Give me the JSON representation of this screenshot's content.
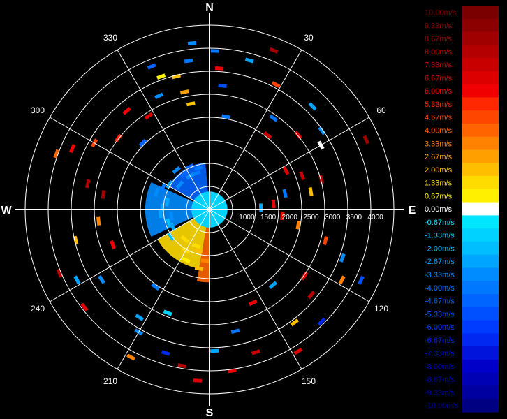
{
  "chart_data": {
    "type": "polar-radar",
    "compass": {
      "north": "N",
      "east": "E",
      "south": "S",
      "west": "W"
    },
    "azimuth_labels": [
      "30",
      "60",
      "120",
      "150",
      "210",
      "240",
      "300",
      "330"
    ],
    "azimuth_degrees": [
      30,
      60,
      120,
      150,
      210,
      240,
      300,
      330
    ],
    "range_labels": [
      "1000",
      "1500",
      "2000",
      "2500",
      "3000",
      "3500",
      "4000"
    ],
    "range_values": [
      1000,
      1500,
      2000,
      2500,
      3000,
      3500,
      4000
    ],
    "range_max": 4300,
    "grid": true,
    "legend_placement": "right",
    "colorbar": {
      "title": "",
      "labels": [
        "10.00m/s",
        "9.33m/s",
        "8.67m/s",
        "8.00m/s",
        "7.33m/s",
        "6.67m/s",
        "6.00m/s",
        "5.33m/s",
        "4.67m/s",
        "4.00m/s",
        "3.33m/s",
        "2.67m/s",
        "2.00m/s",
        "1.33m/s",
        "0.67m/s",
        "0.00m/s",
        "-0.67m/s",
        "-1.33m/s",
        "-2.00m/s",
        "-2.67m/s",
        "-3.33m/s",
        "-4.00m/s",
        "-4.67m/s",
        "-5.33m/s",
        "-6.00m/s",
        "-6.67m/s",
        "-7.33m/s",
        "-8.00m/s",
        "-8.67m/s",
        "-9.33m/s",
        "-10.00m/s"
      ],
      "values": [
        10,
        9.33,
        8.67,
        8,
        7.33,
        6.67,
        6,
        5.33,
        4.67,
        4,
        3.33,
        2.67,
        2,
        1.33,
        0.67,
        0,
        -0.67,
        -1.33,
        -2,
        -2.67,
        -3.33,
        -4,
        -4.67,
        -5.33,
        -6,
        -6.67,
        -7.33,
        -8,
        -8.67,
        -9.33,
        -10
      ],
      "colors": [
        "#7a0000",
        "#8c0000",
        "#a00000",
        "#b40000",
        "#c80000",
        "#dc0000",
        "#f00000",
        "#ff2800",
        "#ff4600",
        "#ff6400",
        "#ff8200",
        "#ffa000",
        "#ffbe00",
        "#ffdc00",
        "#fff000",
        "#ffffff",
        "#00e6ff",
        "#00d2ff",
        "#00beff",
        "#00a5ff",
        "#008cff",
        "#0078ff",
        "#0064ff",
        "#0050ff",
        "#003cff",
        "#0028f0",
        "#0014dc",
        "#0000c8",
        "#0000b4",
        "#0000a0",
        "#000082"
      ]
    },
    "gates": [
      {
        "az": -15,
        "r": 1000,
        "v": -4
      },
      {
        "az": -20,
        "r": 900,
        "v": -4
      },
      {
        "az": -25,
        "r": 1100,
        "v": -4.67
      },
      {
        "az": -30,
        "r": 900,
        "v": -3.33
      },
      {
        "az": -35,
        "r": 1000,
        "v": -4.67
      },
      {
        "az": -40,
        "r": 1200,
        "v": -3.33
      },
      {
        "az": -50,
        "r": 900,
        "v": -3.33
      },
      {
        "az": -58,
        "r": 1100,
        "v": -2.67
      },
      {
        "az": -65,
        "r": 1200,
        "v": -4
      },
      {
        "az": -72,
        "r": 1300,
        "v": -3.33
      },
      {
        "az": -80,
        "r": 1000,
        "v": -2.67
      },
      {
        "az": -88,
        "r": 1100,
        "v": -2.67
      },
      {
        "az": -95,
        "r": 1150,
        "v": -2.67
      },
      {
        "az": -100,
        "r": 900,
        "v": -3.33
      },
      {
        "az": -108,
        "r": 1000,
        "v": -2
      },
      {
        "az": -115,
        "r": 950,
        "v": -2.67
      },
      {
        "az": -125,
        "r": 1100,
        "v": -2
      },
      {
        "az": -140,
        "r": 900,
        "v": 1.33
      },
      {
        "az": -150,
        "r": 1100,
        "v": 1.33
      },
      {
        "az": -155,
        "r": 1300,
        "v": 0.67
      },
      {
        "az": -160,
        "r": 900,
        "v": 1.33
      },
      {
        "az": -165,
        "r": 1000,
        "v": 2
      },
      {
        "az": -170,
        "r": 1400,
        "v": 2
      },
      {
        "az": -175,
        "r": 1200,
        "v": 3.33
      },
      {
        "az": -10,
        "r": 2500,
        "v": 2
      },
      {
        "az": -12,
        "r": 2800,
        "v": 2.67
      },
      {
        "az": -14,
        "r": 3200,
        "v": 2
      },
      {
        "az": -8,
        "r": 3500,
        "v": -4
      },
      {
        "az": -6,
        "r": 3900,
        "v": -3.33
      },
      {
        "az": -22,
        "r": 3600,
        "v": -4.67
      },
      {
        "az": -20,
        "r": 3300,
        "v": 0.67
      },
      {
        "az": -24,
        "r": 2900,
        "v": -3.33
      },
      {
        "az": -33,
        "r": 2600,
        "v": 6.67
      },
      {
        "az": -40,
        "r": 3000,
        "v": 6
      },
      {
        "az": -45,
        "r": 2200,
        "v": -4.67
      },
      {
        "az": -52,
        "r": 2700,
        "v": 5.33
      },
      {
        "az": -60,
        "r": 3100,
        "v": 4.67
      },
      {
        "az": -66,
        "r": 3500,
        "v": 6
      },
      {
        "az": -70,
        "r": 3800,
        "v": 4
      },
      {
        "az": -78,
        "r": 2900,
        "v": 8
      },
      {
        "az": -82,
        "r": 2500,
        "v": 8.67
      },
      {
        "az": -96,
        "r": 2600,
        "v": 3.33
      },
      {
        "az": -103,
        "r": 3200,
        "v": 2
      },
      {
        "az": -110,
        "r": 2400,
        "v": 6
      },
      {
        "az": -113,
        "r": 3800,
        "v": 8
      },
      {
        "az": -118,
        "r": 3500,
        "v": -2.67
      },
      {
        "az": -123,
        "r": 3000,
        "v": -3.33
      },
      {
        "az": -128,
        "r": 3700,
        "v": 6.67
      },
      {
        "az": -145,
        "r": 2200,
        "v": -4
      },
      {
        "az": -147,
        "r": 3000,
        "v": -2.67
      },
      {
        "az": -150,
        "r": 3300,
        "v": -3.33
      },
      {
        "az": -152,
        "r": 3900,
        "v": 3.33
      },
      {
        "az": -158,
        "r": 2600,
        "v": -1.33
      },
      {
        "az": -163,
        "r": 3500,
        "v": -6.67
      },
      {
        "az": -170,
        "r": 3700,
        "v": 8
      },
      {
        "az": -176,
        "r": 4000,
        "v": 6.67
      },
      {
        "az": 2,
        "r": 3700,
        "v": -4
      },
      {
        "az": 4,
        "r": 3300,
        "v": 6
      },
      {
        "az": 6,
        "r": 2900,
        "v": -5.33
      },
      {
        "az": 10,
        "r": 2200,
        "v": -4
      },
      {
        "az": 15,
        "r": 3600,
        "v": -2.67
      },
      {
        "az": 22,
        "r": 4000,
        "v": 8.67
      },
      {
        "az": 28,
        "r": 3300,
        "v": 4.67
      },
      {
        "az": 35,
        "r": 2600,
        "v": -4
      },
      {
        "az": 38,
        "r": 2200,
        "v": 7.33
      },
      {
        "az": 45,
        "r": 3400,
        "v": -2.67
      },
      {
        "az": 50,
        "r": 2700,
        "v": 6.67
      },
      {
        "az": 55,
        "r": 3200,
        "v": -3.33
      },
      {
        "az": 60,
        "r": 3000,
        "v": 0
      },
      {
        "az": 63,
        "r": 2000,
        "v": 6.67
      },
      {
        "az": 66,
        "r": 4000,
        "v": 8.67
      },
      {
        "az": 70,
        "r": 2300,
        "v": 7.33
      },
      {
        "az": 75,
        "r": 2700,
        "v": 8
      },
      {
        "az": 78,
        "r": 1800,
        "v": -4
      },
      {
        "az": 80,
        "r": 2400,
        "v": 2
      },
      {
        "az": 85,
        "r": 1500,
        "v": 6
      },
      {
        "az": 88,
        "r": 1200,
        "v": -2.67
      },
      {
        "az": 95,
        "r": 1700,
        "v": 6
      },
      {
        "az": 100,
        "r": 2100,
        "v": 3.33
      },
      {
        "az": 105,
        "r": 2800,
        "v": 4.67
      },
      {
        "az": 110,
        "r": 3300,
        "v": -3.33
      },
      {
        "az": 115,
        "r": 3900,
        "v": -5.33
      },
      {
        "az": 118,
        "r": 3500,
        "v": 3.33
      },
      {
        "az": 125,
        "r": 2700,
        "v": 6
      },
      {
        "az": 130,
        "r": 3100,
        "v": 8
      },
      {
        "az": 135,
        "r": 3700,
        "v": -6.67
      },
      {
        "az": 140,
        "r": 2300,
        "v": -2.67
      },
      {
        "az": 143,
        "r": 3300,
        "v": 2
      },
      {
        "az": 148,
        "r": 3900,
        "v": 6.67
      },
      {
        "az": 155,
        "r": 2400,
        "v": 6
      },
      {
        "az": 162,
        "r": 3500,
        "v": 7.33
      },
      {
        "az": 168,
        "r": 2900,
        "v": -4
      },
      {
        "az": 172,
        "r": 3800,
        "v": 6
      },
      {
        "az": 178,
        "r": 3300,
        "v": -2.67
      }
    ],
    "near_field": [
      {
        "az_from": -170,
        "az_to": -120,
        "r_from": 200,
        "r_to": 1400,
        "v": 1.33
      },
      {
        "az_from": -115,
        "az_to": -65,
        "r_from": 200,
        "r_to": 1500,
        "v": -3.33
      },
      {
        "az_from": -60,
        "az_to": -5,
        "r_from": 200,
        "r_to": 1100,
        "v": -4.67
      },
      {
        "az_from": -180,
        "az_to": -170,
        "r_from": 200,
        "r_to": 1700,
        "v": 4
      }
    ],
    "center_disk": {
      "r": 420,
      "v": -1.33
    }
  }
}
